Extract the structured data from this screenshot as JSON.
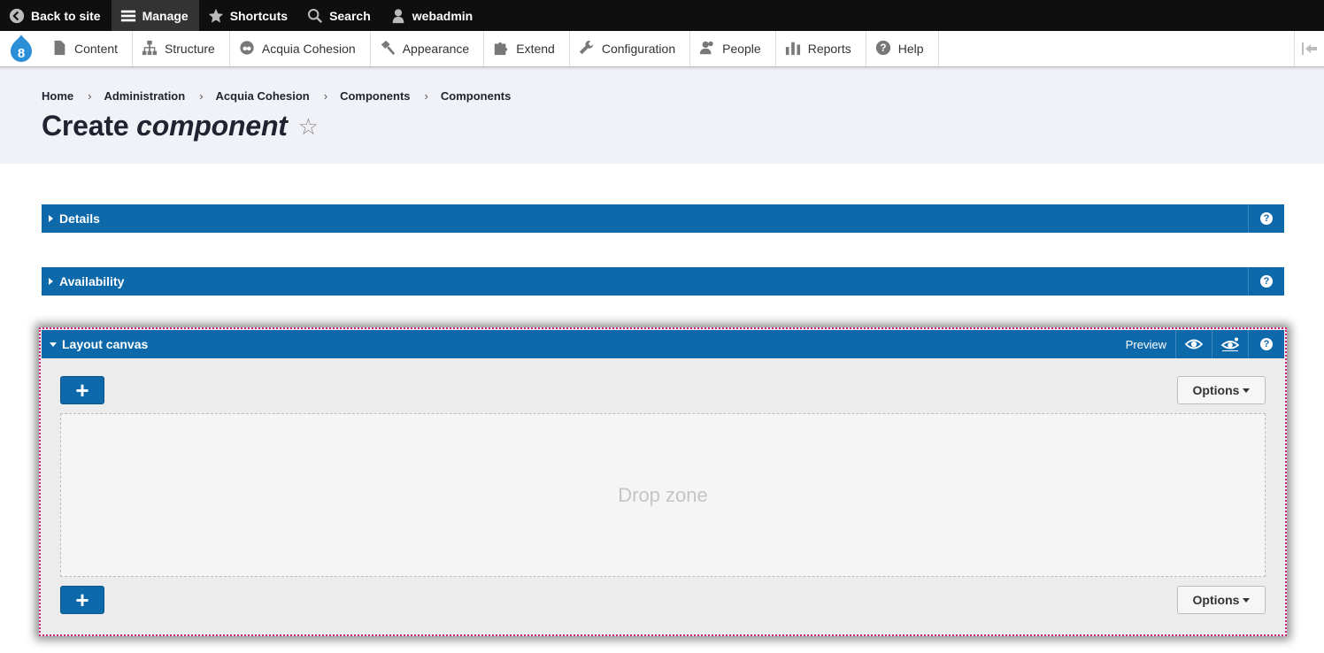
{
  "toolbar": {
    "back": "Back to site",
    "manage": "Manage",
    "shortcuts": "Shortcuts",
    "search": "Search",
    "user": "webadmin"
  },
  "admin_menu": [
    {
      "label": "Content",
      "icon": "document-icon"
    },
    {
      "label": "Structure",
      "icon": "sitemap-icon"
    },
    {
      "label": "Acquia Cohesion",
      "icon": "cohesion-icon"
    },
    {
      "label": "Appearance",
      "icon": "paintbrush-icon"
    },
    {
      "label": "Extend",
      "icon": "puzzle-icon"
    },
    {
      "label": "Configuration",
      "icon": "wrench-icon"
    },
    {
      "label": "People",
      "icon": "people-icon"
    },
    {
      "label": "Reports",
      "icon": "bar-chart-icon"
    },
    {
      "label": "Help",
      "icon": "help-icon"
    }
  ],
  "breadcrumb": [
    "Home",
    "Administration",
    "Acquia Cohesion",
    "Components",
    "Components"
  ],
  "breadcrumb_sep": "›",
  "page_title": {
    "prefix": "Create",
    "emphasis": "component"
  },
  "star": "☆",
  "panels": {
    "details": "Details",
    "availability": "Availability",
    "layout_canvas": "Layout canvas"
  },
  "canvas": {
    "preview": "Preview",
    "add": "+",
    "options": "Options",
    "drop_zone": "Drop zone"
  },
  "help_glyph": "?",
  "colors": {
    "accent": "#0e69ab",
    "canvas_outline": "#d0207a",
    "toolbar_bg": "#0f0f0f",
    "header_bg": "#f1f2f7"
  }
}
